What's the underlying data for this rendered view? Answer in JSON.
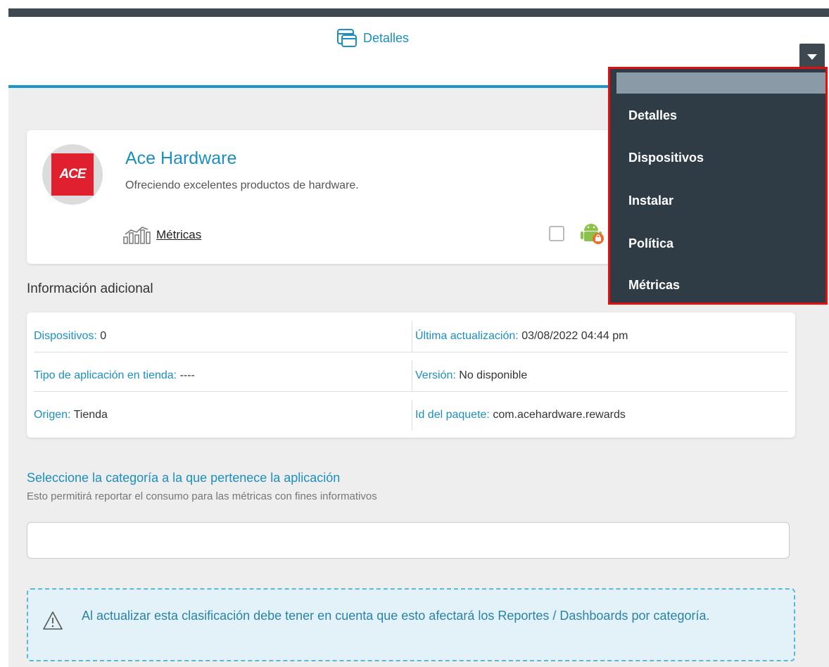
{
  "tabs": {
    "active_label": "Detalles"
  },
  "app": {
    "logo_text": "ACE",
    "name": "Ace Hardware",
    "description": "Ofreciendo excelentes productos de hardware.",
    "metrics_link": "Métricas"
  },
  "info": {
    "title": "Información adicional",
    "rows": [
      {
        "left_label": "Dispositivos:",
        "left_value": "0",
        "right_label": "Última actualización:",
        "right_value": "03/08/2022 04:44 pm"
      },
      {
        "left_label": "Tipo de aplicación en tienda:",
        "left_value": "----",
        "right_label": "Versión:",
        "right_value": "No disponible"
      },
      {
        "left_label": "Origen:",
        "left_value": "Tienda",
        "right_label": "Id del paquete:",
        "right_value": "com.acehardware.rewards"
      }
    ]
  },
  "category": {
    "title": "Seleccione la categoría a la que pertenece la aplicación",
    "subtitle": "Esto permitirá reportar el consumo para las métricas con fines informativos",
    "input_value": ""
  },
  "notice": {
    "text": "Al actualizar esta clasificación debe tener en cuenta que esto afectará los Reportes / Dashboards por categoría."
  },
  "dropdown_menu": {
    "items": [
      "Detalles",
      "Dispositivos",
      "Instalar",
      "Política",
      "Métricas"
    ]
  },
  "colors": {
    "accent": "#1c8fc0",
    "dark": "#2f3b45",
    "highlight_border": "#e01010",
    "ace_red": "#e0202e"
  }
}
